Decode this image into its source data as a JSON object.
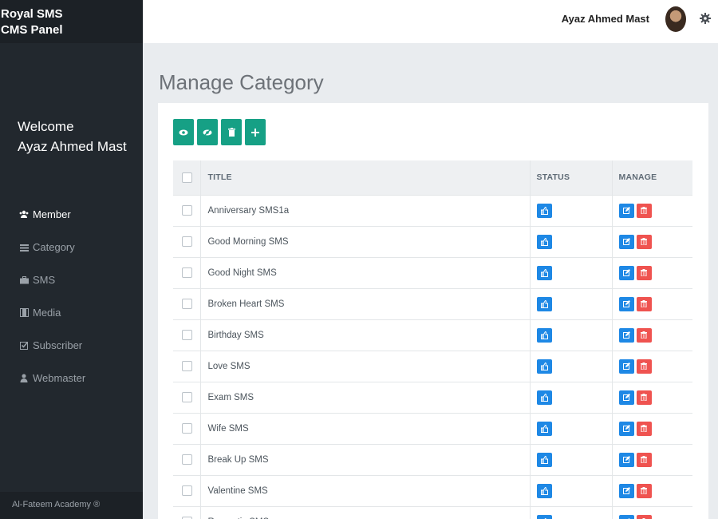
{
  "brand": {
    "line1": "Royal SMS",
    "line2": "CMS Panel"
  },
  "sidebar": {
    "welcome_line1": "Welcome",
    "welcome_line2": "Ayaz Ahmed Mast",
    "items": [
      {
        "label": "Member",
        "icon": "users-icon"
      },
      {
        "label": "Category",
        "icon": "list-icon"
      },
      {
        "label": "SMS",
        "icon": "briefcase-icon"
      },
      {
        "label": "Media",
        "icon": "film-icon"
      },
      {
        "label": "Subscriber",
        "icon": "check-square-icon"
      },
      {
        "label": "Webmaster",
        "icon": "user-icon"
      }
    ],
    "footer": "Al-Fateem Academy ®"
  },
  "header": {
    "username": "Ayaz Ahmed Mast"
  },
  "main": {
    "title": "Manage Category",
    "toolbar": [
      "eye-icon",
      "eye-slash-icon",
      "trash-icon",
      "plus-icon"
    ],
    "table": {
      "headers": {
        "title": "TITLE",
        "status": "STATUS",
        "manage": "MANAGE"
      },
      "rows": [
        "Anniversary SMS1a",
        "Good Morning SMS",
        "Good Night SMS",
        "Broken Heart SMS",
        "Birthday SMS",
        "Love SMS",
        "Exam SMS",
        "Wife SMS",
        "Break Up SMS",
        "Valentine SMS",
        "Romantic SMS"
      ]
    }
  },
  "colors": {
    "sidebar": "#22282e",
    "toolbar_button": "#16a085",
    "status_button": "#1e88e5",
    "delete_button": "#ef5350"
  }
}
